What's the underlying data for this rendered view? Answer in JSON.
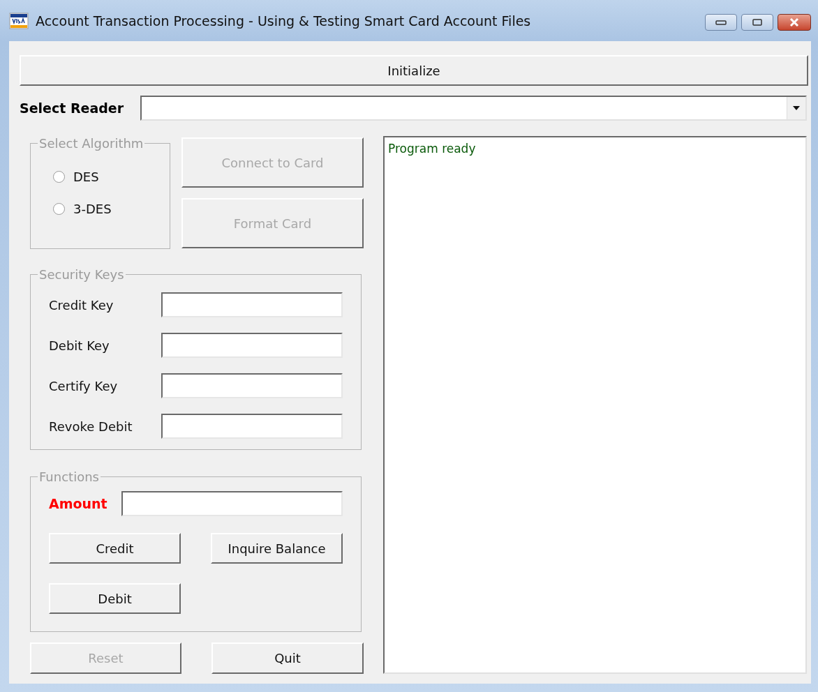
{
  "window": {
    "title": "Account Transaction Processing - Using & Testing Smart Card Account Files"
  },
  "initialize_button": {
    "label": "Initialize",
    "disabled": false
  },
  "reader": {
    "label": "Select Reader"
  },
  "algorithm": {
    "title": "Select Algorithm",
    "options": [
      {
        "label": "DES",
        "selected": false
      },
      {
        "label": "3-DES",
        "selected": false
      }
    ]
  },
  "card_buttons": [
    {
      "label": "Connect to Card",
      "disabled": true
    },
    {
      "label": "Format Card",
      "disabled": true
    }
  ],
  "security_keys": {
    "title": "Security Keys",
    "fields": [
      {
        "label": "Credit Key"
      },
      {
        "label": "Debit Key"
      },
      {
        "label": "Certify Key"
      },
      {
        "label": "Revoke Debit"
      }
    ]
  },
  "functions": {
    "title": "Functions",
    "amount_label": "Amount",
    "buttons": [
      {
        "label": "Credit",
        "disabled": false
      },
      {
        "label": "Inquire Balance",
        "disabled": false
      },
      {
        "label": "Debit",
        "disabled": false
      }
    ]
  },
  "bottom_buttons": [
    {
      "label": "Reset",
      "disabled": true
    },
    {
      "label": "Quit",
      "disabled": false
    }
  ],
  "log": {
    "lines": [
      "Program ready"
    ]
  }
}
